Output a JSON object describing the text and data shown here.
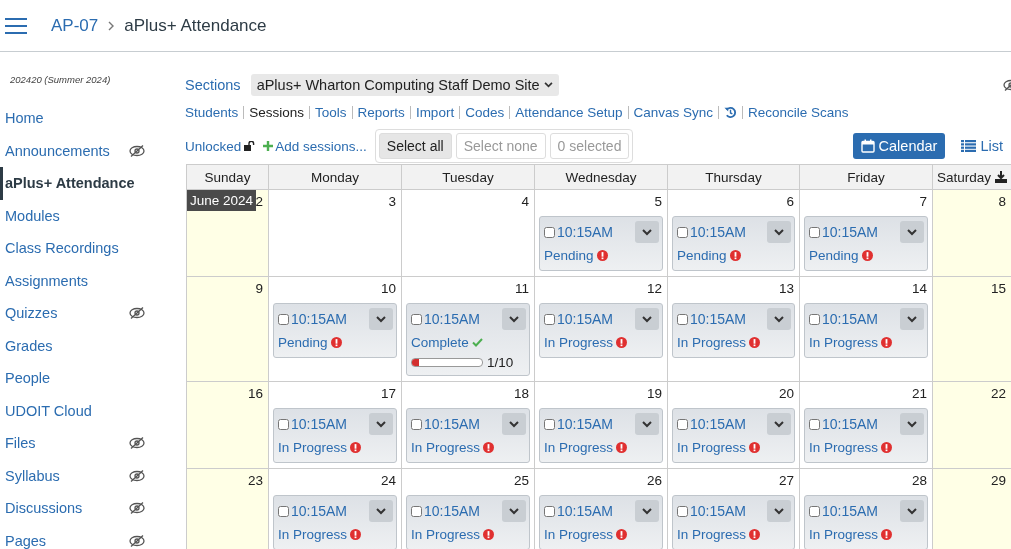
{
  "breadcrumb": [
    "AP-07",
    "aPlus+ Attendance"
  ],
  "sidebar": {
    "term": "202420 (Summer 2024)",
    "items": [
      {
        "label": "Home",
        "selected": false,
        "hidden": false
      },
      {
        "label": "Announcements",
        "selected": false,
        "hidden": true
      },
      {
        "label": "aPlus+ Attendance",
        "selected": true,
        "hidden": false
      },
      {
        "label": "Modules",
        "selected": false,
        "hidden": false
      },
      {
        "label": "Class Recordings",
        "selected": false,
        "hidden": false
      },
      {
        "label": "Assignments",
        "selected": false,
        "hidden": false
      },
      {
        "label": "Quizzes",
        "selected": false,
        "hidden": true
      },
      {
        "label": "Grades",
        "selected": false,
        "hidden": false
      },
      {
        "label": "People",
        "selected": false,
        "hidden": false
      },
      {
        "label": "UDOIT Cloud",
        "selected": false,
        "hidden": false
      },
      {
        "label": "Files",
        "selected": false,
        "hidden": true
      },
      {
        "label": "Syllabus",
        "selected": false,
        "hidden": true
      },
      {
        "label": "Discussions",
        "selected": false,
        "hidden": true
      },
      {
        "label": "Pages",
        "selected": false,
        "hidden": true
      }
    ]
  },
  "sections": {
    "label": "Sections",
    "value": "aPlus+ Wharton Computing Staff Demo Site"
  },
  "nav": [
    {
      "kind": "link",
      "label": "Students",
      "selected": false
    },
    {
      "kind": "link",
      "label": "Sessions",
      "selected": true
    },
    {
      "kind": "link",
      "label": "Tools",
      "selected": false
    },
    {
      "kind": "link",
      "label": "Reports",
      "selected": false
    },
    {
      "kind": "link",
      "label": "Import",
      "selected": false
    },
    {
      "kind": "link",
      "label": "Codes",
      "selected": false
    },
    {
      "kind": "link",
      "label": "Attendance Setup",
      "selected": false
    },
    {
      "kind": "link",
      "label": "Canvas Sync",
      "selected": false
    },
    {
      "kind": "icon",
      "selected": false
    },
    {
      "kind": "link",
      "label": "Reconcile Scans",
      "selected": false
    }
  ],
  "lock": {
    "label": "Unlocked"
  },
  "add_sessions": "Add sessions...",
  "select_buttons": [
    {
      "label": "Select all",
      "disabled": false
    },
    {
      "label": "Select none",
      "disabled": true
    },
    {
      "label": "0 selected",
      "disabled": true
    }
  ],
  "views": [
    {
      "label": "Calendar",
      "selected": true
    },
    {
      "label": "List",
      "selected": false
    }
  ],
  "calendar": {
    "columns": [
      {
        "label": "Sunday",
        "weekend": true
      },
      {
        "label": "Monday",
        "weekend": false
      },
      {
        "label": "Tuesday",
        "weekend": false
      },
      {
        "label": "Wednesday",
        "weekend": false
      },
      {
        "label": "Thursday",
        "weekend": false
      },
      {
        "label": "Friday",
        "weekend": false
      },
      {
        "label": "Saturday",
        "weekend": true,
        "download": true
      }
    ],
    "weeks": [
      {
        "days": [
          {
            "date": "2",
            "month_label": "June 2024"
          },
          {
            "date": "3"
          },
          {
            "date": "4"
          },
          {
            "date": "5",
            "sessions": [
              {
                "time": "10:15AM",
                "status": "Pending",
                "kind": "alert",
                "checked": false
              }
            ]
          },
          {
            "date": "6",
            "sessions": [
              {
                "time": "10:15AM",
                "status": "Pending",
                "kind": "alert",
                "checked": false
              }
            ]
          },
          {
            "date": "7",
            "sessions": [
              {
                "time": "10:15AM",
                "status": "Pending",
                "kind": "alert",
                "checked": false
              }
            ]
          },
          {
            "date": "8"
          }
        ]
      },
      {
        "days": [
          {
            "date": "9"
          },
          {
            "date": "10",
            "sessions": [
              {
                "time": "10:15AM",
                "status": "Pending",
                "kind": "alert",
                "checked": false
              }
            ]
          },
          {
            "date": "11",
            "sessions": [
              {
                "time": "10:15AM",
                "status": "Complete",
                "kind": "done",
                "checked": false,
                "level": 0.1,
                "count": "1/10"
              }
            ]
          },
          {
            "date": "12",
            "sessions": [
              {
                "time": "10:15AM",
                "status": "In Progress",
                "kind": "alert",
                "checked": false
              }
            ]
          },
          {
            "date": "13",
            "sessions": [
              {
                "time": "10:15AM",
                "status": "In Progress",
                "kind": "alert",
                "checked": false
              }
            ]
          },
          {
            "date": "14",
            "sessions": [
              {
                "time": "10:15AM",
                "status": "In Progress",
                "kind": "alert",
                "checked": false
              }
            ]
          },
          {
            "date": "15"
          }
        ]
      },
      {
        "days": [
          {
            "date": "16"
          },
          {
            "date": "17",
            "sessions": [
              {
                "time": "10:15AM",
                "status": "In Progress",
                "kind": "alert",
                "checked": false
              }
            ]
          },
          {
            "date": "18",
            "sessions": [
              {
                "time": "10:15AM",
                "status": "In Progress",
                "kind": "alert",
                "checked": false
              }
            ]
          },
          {
            "date": "19",
            "sessions": [
              {
                "time": "10:15AM",
                "status": "In Progress",
                "kind": "alert",
                "checked": false
              }
            ]
          },
          {
            "date": "20",
            "sessions": [
              {
                "time": "10:15AM",
                "status": "In Progress",
                "kind": "alert",
                "checked": false
              }
            ]
          },
          {
            "date": "21",
            "sessions": [
              {
                "time": "10:15AM",
                "status": "In Progress",
                "kind": "alert",
                "checked": false
              }
            ]
          },
          {
            "date": "22"
          }
        ]
      },
      {
        "days": [
          {
            "date": "23"
          },
          {
            "date": "24",
            "sessions": [
              {
                "time": "10:15AM",
                "status": "In Progress",
                "kind": "alert",
                "checked": false
              }
            ]
          },
          {
            "date": "25",
            "sessions": [
              {
                "time": "10:15AM",
                "status": "In Progress",
                "kind": "alert",
                "checked": false
              }
            ]
          },
          {
            "date": "26",
            "sessions": [
              {
                "time": "10:15AM",
                "status": "In Progress",
                "kind": "alert",
                "checked": false
              }
            ]
          },
          {
            "date": "27",
            "sessions": [
              {
                "time": "10:15AM",
                "status": "In Progress",
                "kind": "alert",
                "checked": false
              }
            ]
          },
          {
            "date": "28",
            "sessions": [
              {
                "time": "10:15AM",
                "status": "In Progress",
                "kind": "alert",
                "checked": false
              }
            ]
          },
          {
            "date": "29"
          }
        ]
      }
    ]
  }
}
